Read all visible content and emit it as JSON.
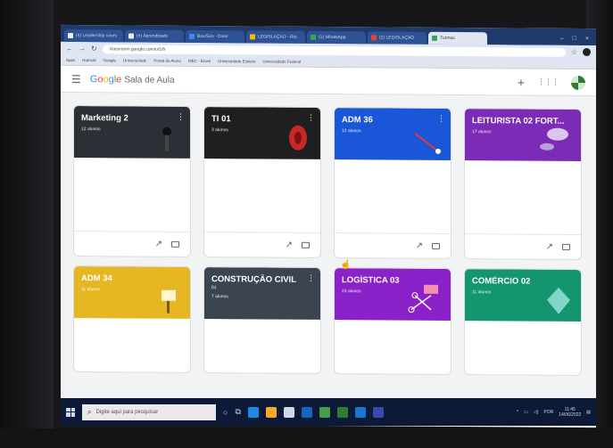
{
  "browser": {
    "tabs": [
      {
        "label": "(n) Leadership cours",
        "color": "#e8eaed",
        "active": false
      },
      {
        "label": "(n) Aprendizado",
        "color": "#e8eaed",
        "active": false
      },
      {
        "label": "Box/Sim - Diver",
        "color": "#4285f4",
        "active": false
      },
      {
        "label": "LEGISLAÇÃO - Rio",
        "color": "#fbbc05",
        "active": false
      },
      {
        "label": "(1) WhatsApp",
        "color": "#34a853",
        "active": false
      },
      {
        "label": "(2) LEGISLAÇÃO",
        "color": "#ea4335",
        "active": false
      },
      {
        "label": "Turmas",
        "color": "#34a853",
        "active": true
      }
    ],
    "window_controls": [
      "–",
      "□",
      "×"
    ],
    "url": "classroom.google.com/u/1/h",
    "bookmarks": [
      "Apps",
      "Hotmail",
      "Google",
      "Universidade",
      "Portal do Aluno",
      "MEC - Brasil",
      "Universidade Estácio",
      "Universidade Federal"
    ]
  },
  "app": {
    "logo_google": [
      "G",
      "o",
      "o",
      "g",
      "l",
      "e"
    ],
    "logo_product": "Sala de Aula"
  },
  "cards": [
    {
      "title": "Marketing 2",
      "section": "",
      "students": "12 alunos",
      "color": "#2d2f36"
    },
    {
      "title": "TI 01",
      "section": "",
      "students": "3 alunos",
      "color": "#1f1f22"
    },
    {
      "title": "ADM 36",
      "section": "",
      "students": "12 alunos",
      "color": "#1a56d8"
    },
    {
      "title": "LEITURISTA 02 FORT...",
      "section": "",
      "students": "17 alunos",
      "color": "#7b2bb5"
    },
    {
      "title": "ADM 34",
      "section": "",
      "students": "11 alunos",
      "color": "#e6b722"
    },
    {
      "title": "CONSTRUÇÃO CIVIL",
      "section": "01",
      "students": "7 alunos",
      "color": "#3c4451"
    },
    {
      "title": "LOGÍSTICA 03",
      "section": "",
      "students": "23 alunos",
      "color": "#8b22c9"
    },
    {
      "title": "COMÉRCIO 02",
      "section": "",
      "students": "11 alunos",
      "color": "#13966f"
    }
  ],
  "taskbar": {
    "search_placeholder": "Digite aqui para pesquisar",
    "clock_time": "11:45",
    "clock_date": "14/06/2022",
    "tray_lang": "POR"
  }
}
